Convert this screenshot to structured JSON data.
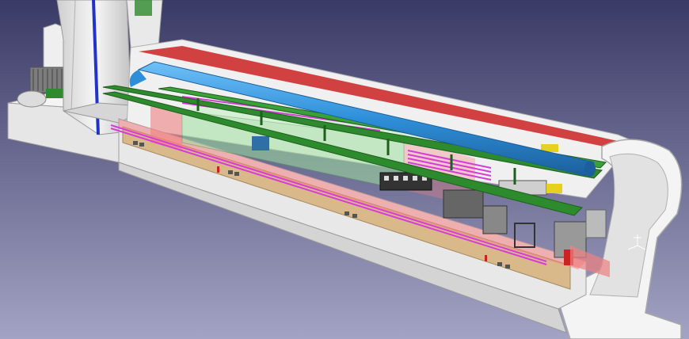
{
  "viewport": {
    "background_top": "#3a3a66",
    "background_bottom": "#a3a3c4"
  },
  "model": {
    "tunnel_color": "#f0f0f0",
    "tunnel_edge": "#b8b8b8",
    "floor_color": "#d9b98a",
    "cable_tray_color": "#cc2222",
    "water_pipe_color": "#2e8fd8",
    "rail_color": "#2d8a2d",
    "magenta_pipes": "#d83cd8",
    "blue_pipe_color": "#2233cc",
    "glass_green": "#9fe09f",
    "glass_red": "#f08080"
  },
  "compass": {
    "axes": [
      "x",
      "y",
      "z"
    ],
    "icon": "axis-compass-icon"
  }
}
